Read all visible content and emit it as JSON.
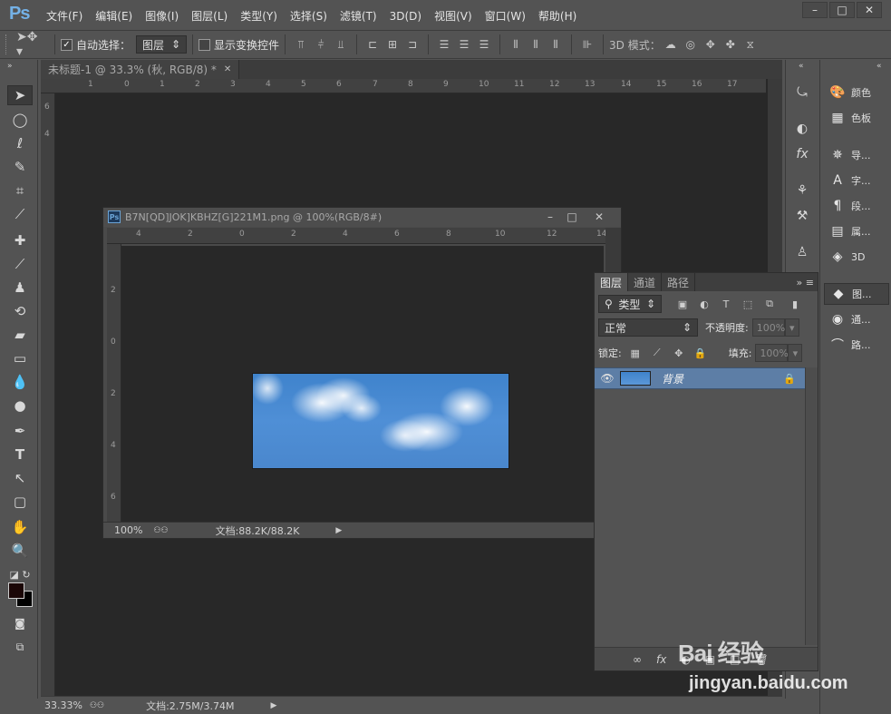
{
  "app": {
    "logo": "Ps"
  },
  "menu": [
    "文件(F)",
    "编辑(E)",
    "图像(I)",
    "图层(L)",
    "类型(Y)",
    "选择(S)",
    "滤镜(T)",
    "3D(D)",
    "视图(V)",
    "窗口(W)",
    "帮助(H)"
  ],
  "window_controls": [
    "–",
    "□",
    "✕"
  ],
  "options": {
    "tool_icon": "move-tool-icon",
    "auto_select_label": "自动选择：",
    "auto_select_checked": "✓",
    "auto_select_value": "图层",
    "show_transform_label": "显示变换控件",
    "mode3d_label": "3D 模式："
  },
  "main_tab": {
    "title": "未标题-1 @ 33.3% (秋, RGB/8) *",
    "close": "✕"
  },
  "main_ruler": [
    "1",
    "0",
    "1",
    "2",
    "3",
    "4",
    "5",
    "6",
    "7",
    "8",
    "9",
    "10",
    "11",
    "12",
    "13",
    "14",
    "15",
    "16",
    "17"
  ],
  "main_ruler_v": [
    "6",
    "4"
  ],
  "doc": {
    "icon": "Ps",
    "title": "B7N[QD]JOK]KBHZ[G]221M1.png @ 100%(RGB/8#)",
    "ruler_h": [
      "4",
      "2",
      "0",
      "2",
      "4",
      "6",
      "8",
      "10",
      "12",
      "14"
    ],
    "ruler_v": [
      "2",
      "0",
      "2",
      "4",
      "6"
    ],
    "zoom": "100%",
    "doc_size": "文档:88.2K/88.2K"
  },
  "status": {
    "zoom": "33.33%",
    "doc_size": "文档:2.75M/3.74M"
  },
  "dock": [
    {
      "label": "颜色",
      "icon": "palette-icon",
      "glyph": "🎨"
    },
    {
      "label": "色板",
      "icon": "swatches-icon",
      "glyph": "▦"
    },
    {
      "label": "导...",
      "icon": "navigator-icon",
      "glyph": "✵"
    },
    {
      "label": "字...",
      "icon": "character-icon",
      "glyph": "A"
    },
    {
      "label": "段...",
      "icon": "paragraph-icon",
      "glyph": "¶"
    },
    {
      "label": "属...",
      "icon": "properties-icon",
      "glyph": "▤"
    },
    {
      "label": "3D",
      "icon": "cube-icon",
      "glyph": "◈"
    },
    {
      "label": "图...",
      "icon": "layers-icon",
      "glyph": "◆"
    },
    {
      "label": "通...",
      "icon": "channels-icon",
      "glyph": "◉"
    },
    {
      "label": "路...",
      "icon": "paths-icon",
      "glyph": "⌒"
    }
  ],
  "layers": {
    "tabs": [
      "图层",
      "通道",
      "路径"
    ],
    "filter_label": "类型",
    "blend_mode": "正常",
    "opacity_label": "不透明度:",
    "opacity_value": "100%",
    "lock_label": "锁定:",
    "fill_label": "填充:",
    "fill_value": "100%",
    "layer_name": "背景",
    "footer_icons": [
      "∞",
      "fx",
      "◐",
      "▣",
      "□",
      "🗑"
    ]
  },
  "watermark": {
    "logo": "Bai 经验",
    "url": "jingyan.baidu.com"
  }
}
